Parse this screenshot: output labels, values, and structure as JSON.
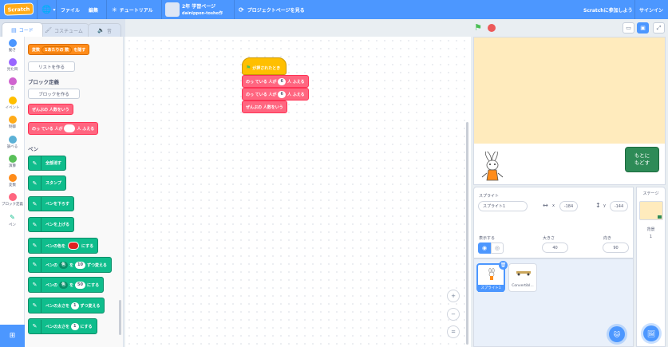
{
  "menubar": {
    "logo": "Scratch",
    "globe_caret": "▾",
    "file": "ファイル",
    "edit": "編集",
    "tutorial": "チュートリアル",
    "project_title": "2年 学習ページ",
    "project_user": "dainippon-tosho作",
    "see_project": "プロジェクトページを見る",
    "join": "Scratchに参加しよう",
    "signin": "サインイン"
  },
  "tabs": {
    "code": "コード",
    "costume": "コスチューム",
    "sound": "音"
  },
  "categories": [
    "動き",
    "見た目",
    "音",
    "イベント",
    "制御",
    "調べる",
    "演算",
    "変数",
    "ブロック定義",
    "ペン"
  ],
  "category_colors": [
    "#4c97ff",
    "#9966ff",
    "#cf63cf",
    "#ffbf00",
    "#ffab19",
    "#5cb1d6",
    "#59c059",
    "#ff8c1a",
    "#ff6680",
    "#0fbd8c"
  ],
  "palette": {
    "var_block": {
      "pre": "変数",
      "var": "1あたりの 数",
      "post": "を隠す"
    },
    "make_list": "リストを作る",
    "myblocks_title": "ブロック定義",
    "make_block": "ブロックを作る",
    "block_zenbu": "ぜんぶの 人数をいう",
    "block_notteiru": {
      "pre": "のっ ている 人が",
      "post": "人 ふえる"
    },
    "pen_title": "ペン",
    "pen_blocks": {
      "clear": "全部消す",
      "stamp": "スタンプ",
      "pen_down": "ペンを下ろす",
      "pen_up": "ペンを上げる",
      "color_set": {
        "pre": "ペンの色を",
        "post": "にする"
      },
      "change_param": {
        "pre": "ペンの",
        "param": "色",
        "mid": "を",
        "val": "10",
        "post": "ずつ変える"
      },
      "set_param": {
        "pre": "ペンの",
        "param": "色",
        "mid": "を",
        "val": "50",
        "post": "にする"
      },
      "change_size": {
        "pre": "ペンの太さを",
        "val": "1",
        "post": "ずつ変える"
      },
      "set_size": {
        "pre": "ペンの太さを",
        "val": "1",
        "post": "にする"
      }
    }
  },
  "script": {
    "hat": "が押されたとき",
    "line1": {
      "pre": "のっ ている 人が",
      "val": "6",
      "post": "人 ふえる"
    },
    "line2": {
      "pre": "のっ ている 人が",
      "val": "6",
      "post": "人 ふえる"
    },
    "line3": "ぜんぶの 人数をいう"
  },
  "zoom": {
    "in": "+",
    "out": "−",
    "reset": "="
  },
  "stage": {
    "reset_button": "もとに\nもどす"
  },
  "sprite_info": {
    "sprite_label": "スプライト",
    "sprite_name": "スプライト1",
    "x_label": "x",
    "x_value": "-184",
    "y_label": "y",
    "y_value": "-144",
    "show_label": "表示する",
    "size_label": "大きさ",
    "size_value": "40",
    "direction_label": "向き",
    "direction_value": "90"
  },
  "sprites": [
    "スプライト1",
    "Convertibl..."
  ],
  "stage_pane": {
    "title": "ステージ",
    "backdrops_label": "背景",
    "backdrops_count": "1"
  },
  "colors": {
    "accent": "#4c97ff",
    "stage_bg": "#ffebbd",
    "pen_color": "#e02020"
  }
}
